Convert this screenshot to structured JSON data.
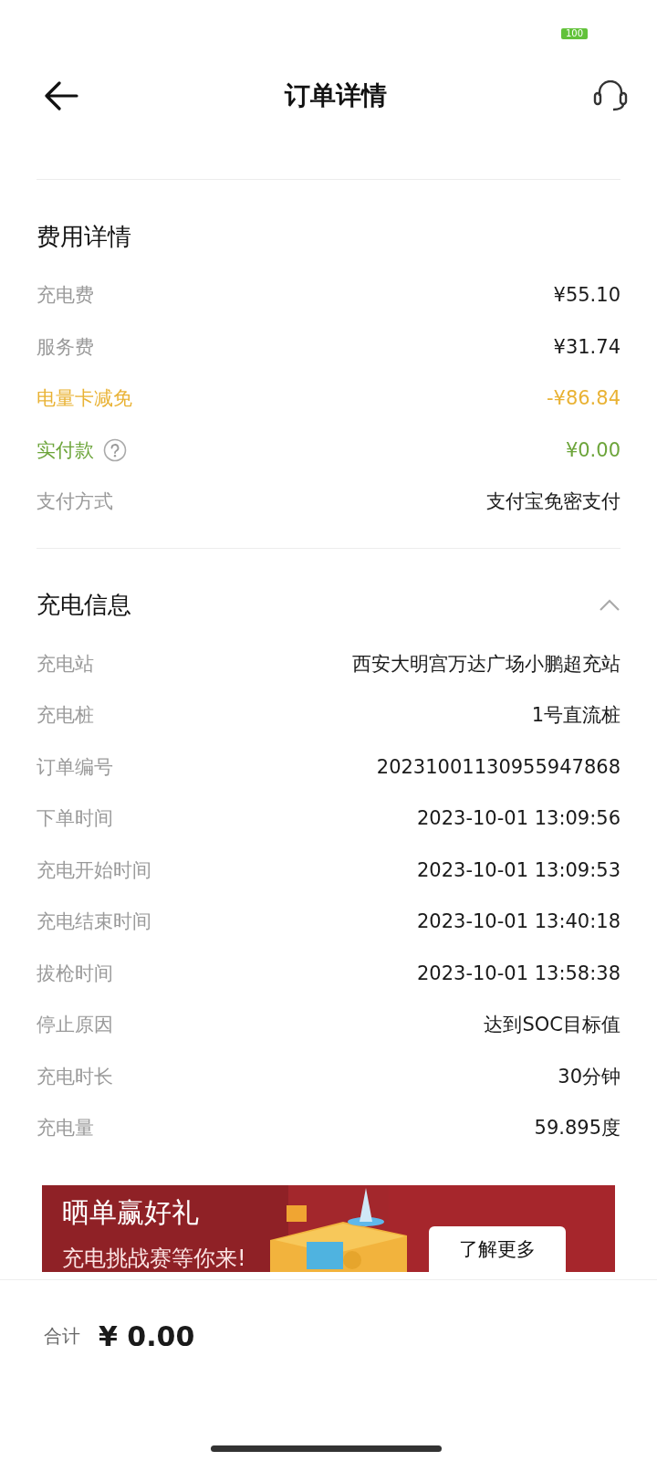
{
  "status_bar": {
    "battery": "100"
  },
  "header": {
    "title": "订单详情"
  },
  "fee_section": {
    "title": "费用详情",
    "rows": [
      {
        "label": "充电费",
        "value": "¥55.10",
        "kind": "normal",
        "help": false
      },
      {
        "label": "服务费",
        "value": "¥31.74",
        "kind": "normal",
        "help": false
      },
      {
        "label": "电量卡减免",
        "value": "-¥86.84",
        "kind": "discount",
        "help": false
      },
      {
        "label": "实付款",
        "value": "¥0.00",
        "kind": "paid",
        "help": true
      },
      {
        "label": "支付方式",
        "value": "支付宝免密支付",
        "kind": "normal",
        "help": false
      }
    ]
  },
  "charge_section": {
    "title": "充电信息",
    "expanded": true,
    "rows": [
      {
        "label": "充电站",
        "value": "西安大明宫万达广场小鹏超充站"
      },
      {
        "label": "充电桩",
        "value": "1号直流桩"
      },
      {
        "label": "订单编号",
        "value": "20231001130955947868"
      },
      {
        "label": "下单时间",
        "value": "2023-10-01 13:09:56"
      },
      {
        "label": "充电开始时间",
        "value": "2023-10-01 13:09:53"
      },
      {
        "label": "充电结束时间",
        "value": "2023-10-01 13:40:18"
      },
      {
        "label": "拔枪时间",
        "value": "2023-10-01 13:58:38"
      },
      {
        "label": "停止原因",
        "value": "达到SOC目标值"
      },
      {
        "label": "充电时长",
        "value": "30分钟"
      },
      {
        "label": "充电量",
        "value": "59.895度"
      }
    ]
  },
  "banner": {
    "title": "晒单赢好礼",
    "subtitle": "充电挑战赛等你来!",
    "button": "了解更多"
  },
  "footer": {
    "label": "合计",
    "amount": "¥ 0.00"
  }
}
